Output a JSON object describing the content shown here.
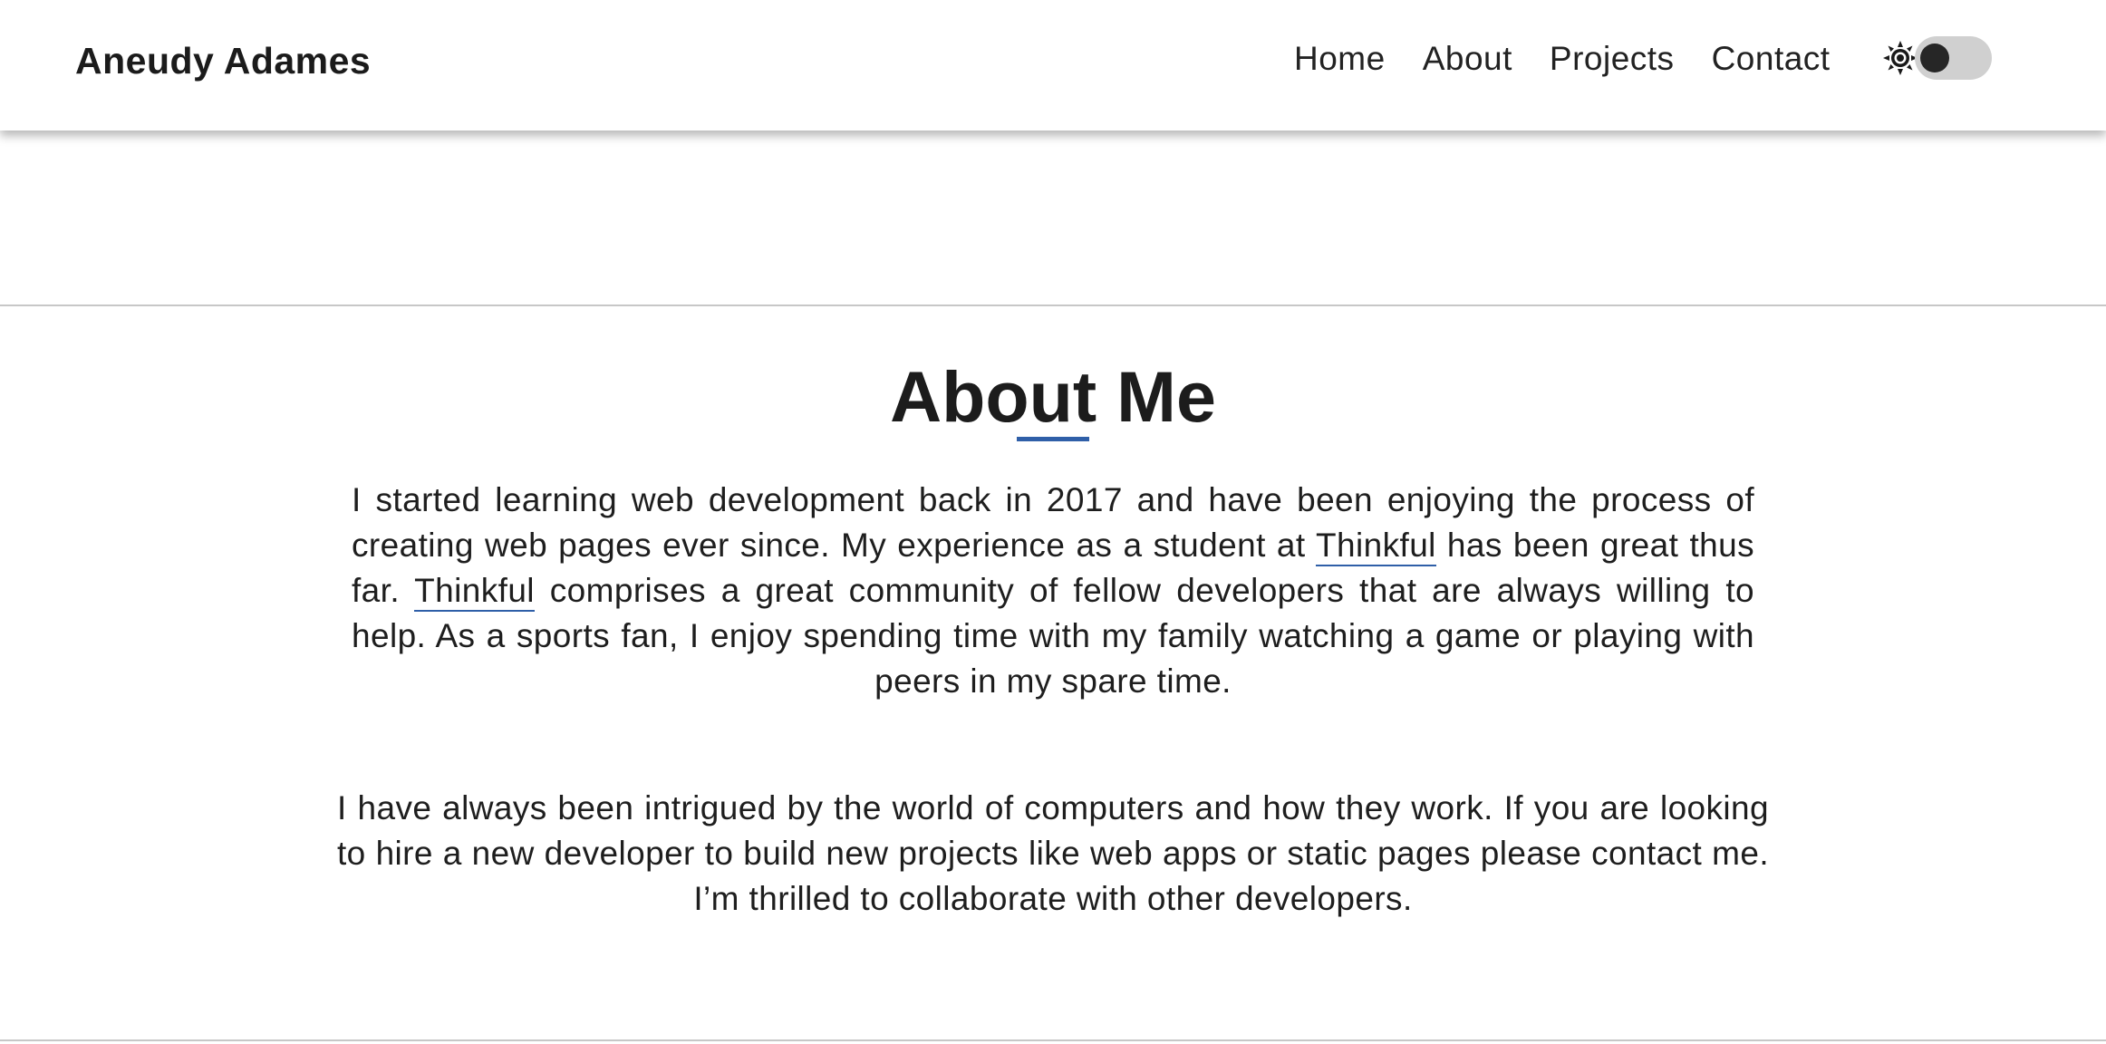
{
  "header": {
    "brand": "Aneudy Adames",
    "nav": [
      {
        "label": "Home"
      },
      {
        "label": "About"
      },
      {
        "label": "Projects"
      },
      {
        "label": "Contact"
      }
    ],
    "theme_toggle": {
      "icon": "sun-icon",
      "state": "off"
    }
  },
  "about": {
    "title": "About Me",
    "p1": {
      "part1": "I started learning web development back in 2017 and have been enjoying the process of creating web pages ever since. My experience as a student at ",
      "link1": "Thinkful",
      "part2": " has been great thus far. ",
      "link2": "Thinkful",
      "part3": " comprises a great community of fellow developers that are always willing to help. As a sports fan, I enjoy spending time with my family watching a game or playing with peers in my spare time."
    },
    "p2": "I have always been intrigued by the world of computers and how they work. If you are looking to hire a new developer to build new projects like web apps or static pages please contact me. I’m thrilled to collaborate with other developers."
  },
  "colors": {
    "accent": "#2f5fa8",
    "text": "#1e1e1e",
    "toggle_track": "#d0d0d0",
    "toggle_knob": "#262626",
    "divider": "#c7c7c7"
  }
}
